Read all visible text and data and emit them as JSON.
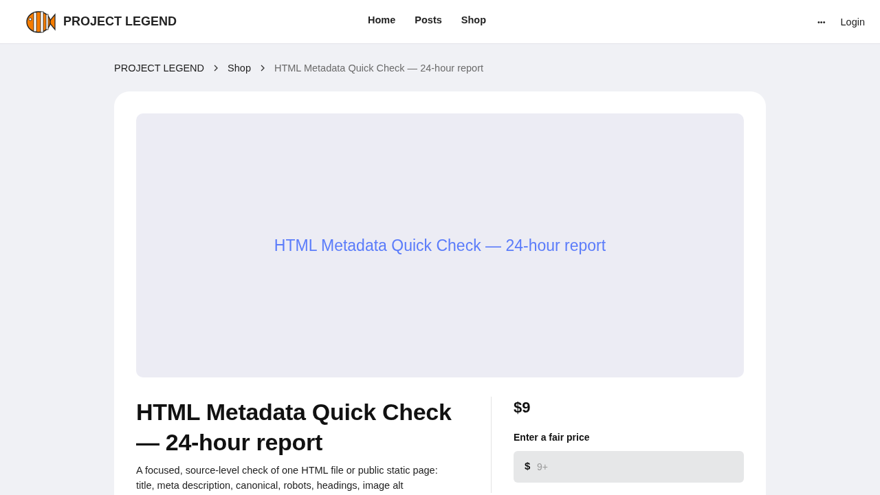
{
  "header": {
    "brand": "PROJECT LEGEND",
    "nav": [
      {
        "label": "Home"
      },
      {
        "label": "Posts"
      },
      {
        "label": "Shop"
      }
    ],
    "more": "•••",
    "login": "Login"
  },
  "breadcrumb": [
    {
      "label": "PROJECT LEGEND",
      "current": false
    },
    {
      "label": "Shop",
      "current": false
    },
    {
      "label": "HTML Metadata Quick Check — 24-hour report",
      "current": true
    }
  ],
  "product": {
    "cover_title": "HTML Metadata Quick Check — 24-hour report",
    "title": "HTML Metadata Quick Check — 24-hour report",
    "description": "A focused, source-level check of one HTML file or public static page: title, meta description, canonical, robots, headings, image alt",
    "price": "$9",
    "price_label": "Enter a fair price",
    "currency": "$",
    "price_placeholder": "9+"
  }
}
